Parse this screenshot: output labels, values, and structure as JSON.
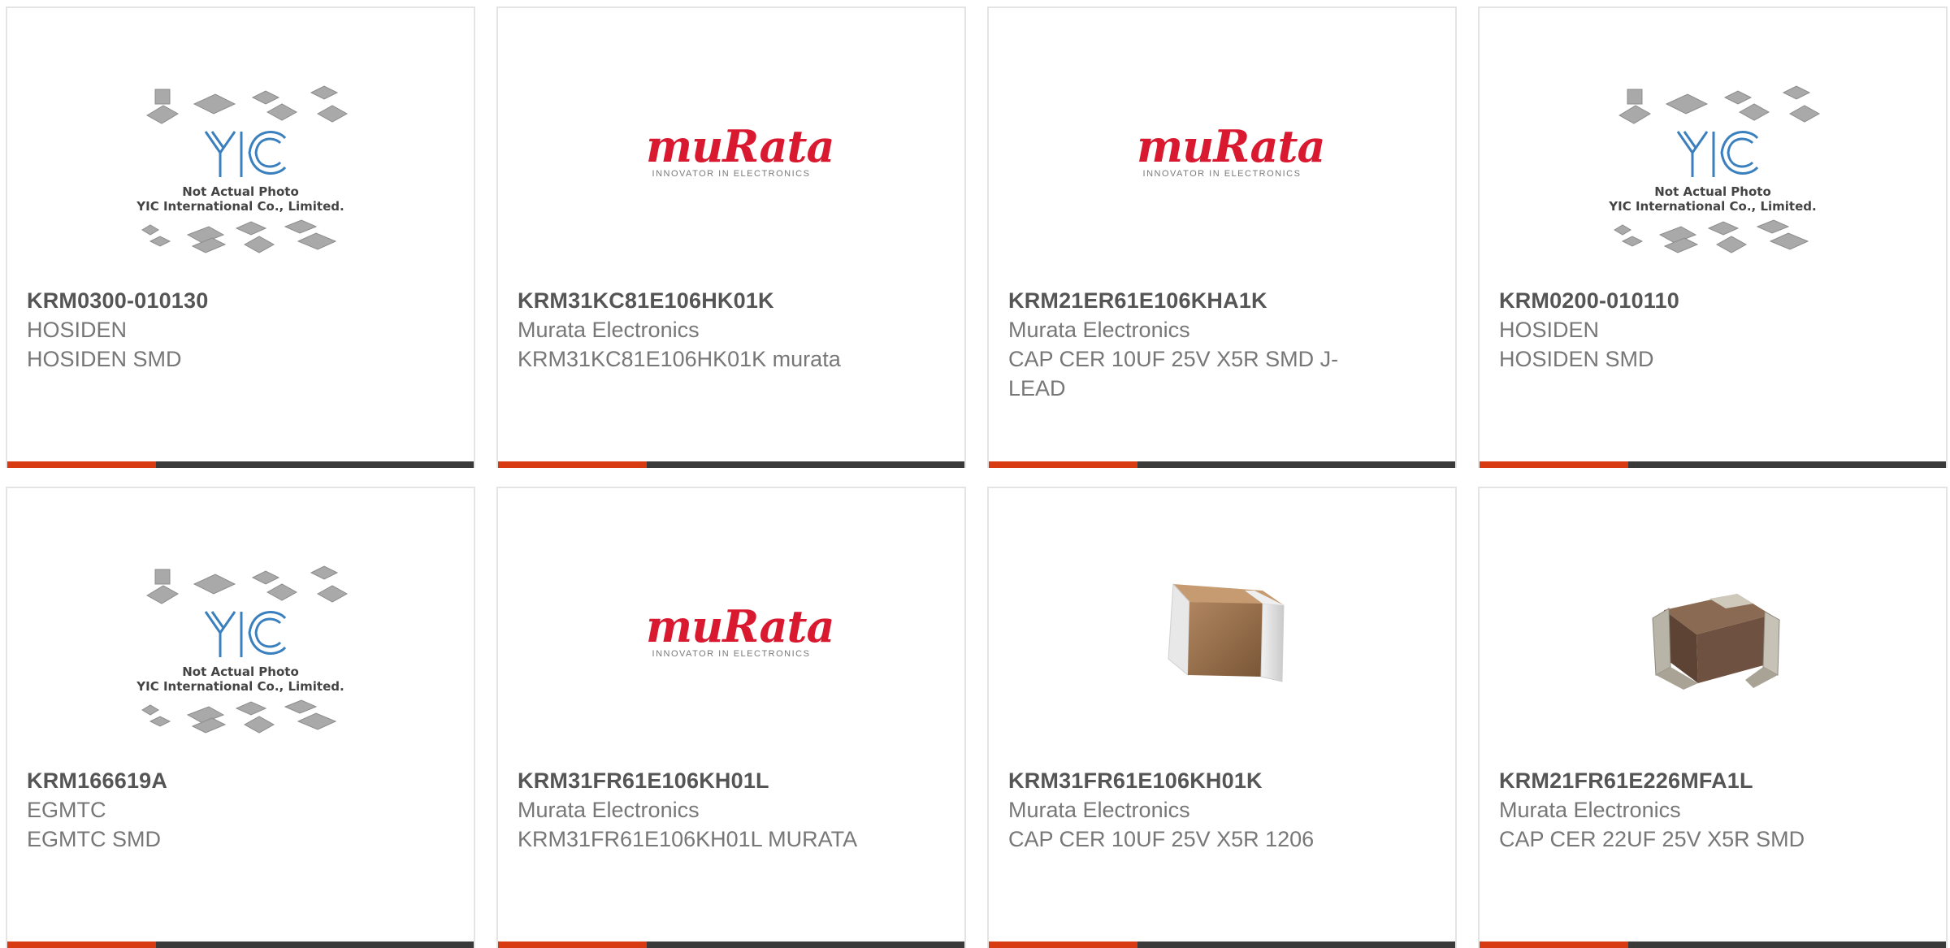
{
  "products": [
    {
      "part_number": "KRM0300-010130",
      "manufacturer": "HOSIDEN",
      "description": "HOSIDEN SMD",
      "image": "yic-placeholder",
      "image_caption": [
        "Not Actual Photo",
        "YIC International Co., Limited."
      ]
    },
    {
      "part_number": "KRM31KC81E106HK01K",
      "manufacturer": "Murata Electronics",
      "description": "KRM31KC81E106HK01K murata",
      "image": "murata-logo",
      "logo_text": "muRata",
      "logo_tagline": "INNOVATOR IN ELECTRONICS"
    },
    {
      "part_number": "KRM21ER61E106KHA1K",
      "manufacturer": "Murata Electronics",
      "description": "CAP CER 10UF 25V X5R SMD J-LEAD",
      "image": "murata-logo",
      "logo_text": "muRata",
      "logo_tagline": "INNOVATOR IN ELECTRONICS"
    },
    {
      "part_number": "KRM0200-010110",
      "manufacturer": "HOSIDEN",
      "description": "HOSIDEN SMD",
      "image": "yic-placeholder",
      "image_caption": [
        "Not Actual Photo",
        "YIC International Co., Limited."
      ]
    },
    {
      "part_number": "KRM166619A",
      "manufacturer": "EGMTC",
      "description": "EGMTC SMD",
      "image": "yic-placeholder",
      "image_caption": [
        "Not Actual Photo",
        "YIC International Co., Limited."
      ]
    },
    {
      "part_number": "KRM31FR61E106KH01L",
      "manufacturer": "Murata Electronics",
      "description": "KRM31FR61E106KH01L MURATA",
      "image": "murata-logo",
      "logo_text": "muRata",
      "logo_tagline": "INNOVATOR IN ELECTRONICS"
    },
    {
      "part_number": "KRM31FR61E106KH01K",
      "manufacturer": "Murata Electronics",
      "description": "CAP CER 10UF 25V X5R 1206",
      "image": "capacitor-chip-photo"
    },
    {
      "part_number": "KRM21FR61E226MFA1L",
      "manufacturer": "Murata Electronics",
      "description": "CAP CER 22UF 25V X5R SMD",
      "image": "capacitor-jlead-photo"
    }
  ],
  "colors": {
    "accent": "#d83a12",
    "bar": "#3a3a3a",
    "text": "#777777",
    "part_number": "#555555",
    "murata_red": "#d8192f",
    "border": "#e4e4e4"
  }
}
